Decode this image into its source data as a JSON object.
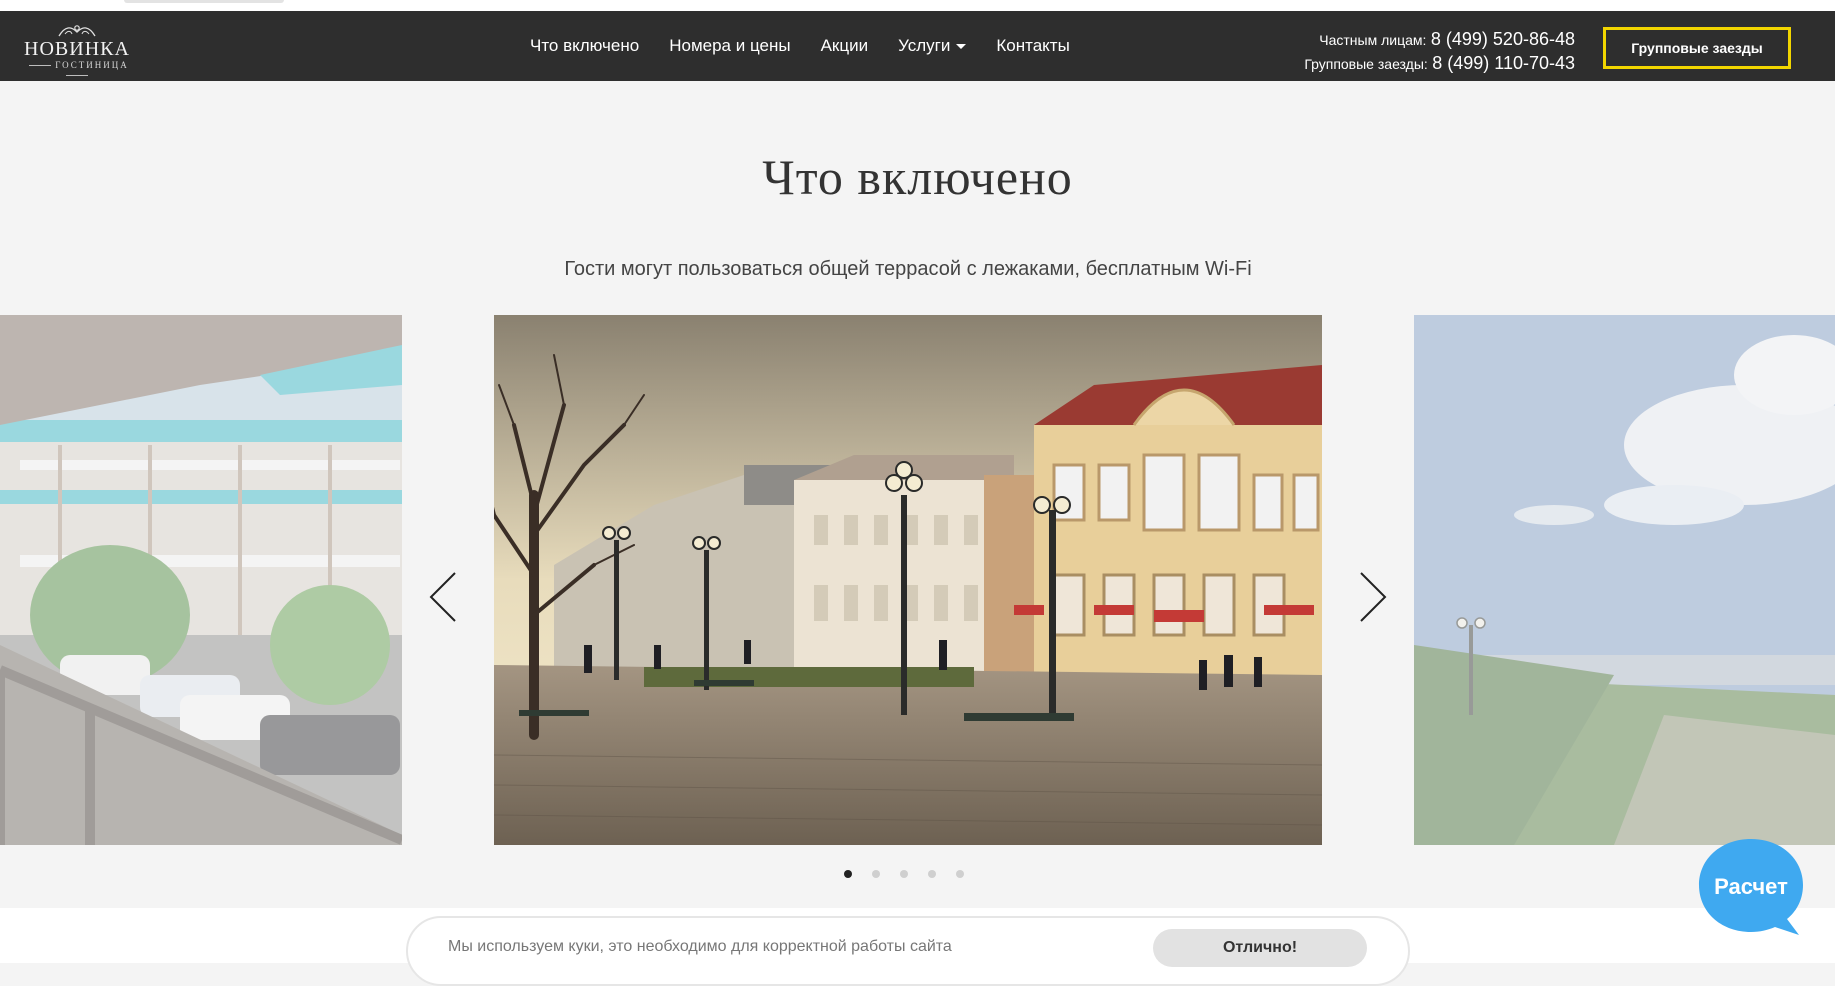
{
  "header": {
    "logo": {
      "name": "НОВИНКА",
      "subtitle": "ГОСТИНИЦА"
    },
    "menu": [
      {
        "label": "Что включено"
      },
      {
        "label": "Номера и цены"
      },
      {
        "label": "Акции"
      },
      {
        "label": "Услуги",
        "has_dropdown": true
      },
      {
        "label": "Контакты"
      }
    ],
    "phones": {
      "private_label": "Частным лицам:",
      "private_number": "8 (499) 520-86-48",
      "group_label": "Групповые заезды:",
      "group_number": "8 (499) 110-70-43"
    },
    "group_button": "Групповые заезды",
    "colors": {
      "bar": "#2e2e2e",
      "button_border": "#f2d600"
    }
  },
  "main": {
    "title": "Что включено",
    "subtitle": "Гости могут пользоваться общей террасой с лежаками, бесплатным Wi-Fi",
    "carousel": {
      "slides": [
        {
          "name": "hotel-terrace-photo"
        },
        {
          "name": "town-street-photo"
        },
        {
          "name": "seaside-promenade-photo"
        }
      ],
      "dots_total": 5,
      "active_dot": 1
    }
  },
  "cookie": {
    "text": "Мы используем куки, это необходимо для корректной работы сайта",
    "button": "Отлично!"
  },
  "calc": {
    "label": "Расчет",
    "color": "#3fa9f0"
  }
}
